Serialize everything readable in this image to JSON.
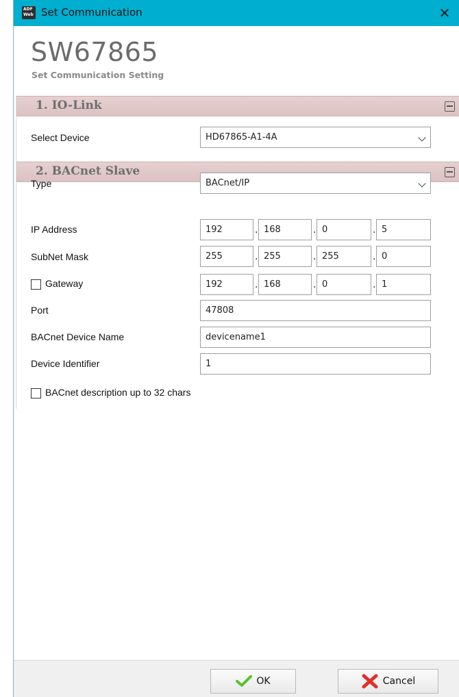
{
  "window": {
    "title": "Set Communication",
    "icon_line1": "ADF",
    "icon_line2": "Web",
    "close_glyph": "✕"
  },
  "header": {
    "product_code": "SW67865",
    "subtitle": "Set Communication Setting"
  },
  "io_link": {
    "section_title": "1. IO-Link",
    "select_device_label": "Select Device",
    "select_device_value": "HD67865-A1-4A"
  },
  "bacnet": {
    "section_title": "2. BACnet Slave",
    "type_label": "Type",
    "type_value": "BACnet/IP",
    "ip_label": "IP Address",
    "ip": [
      "192",
      "168",
      "0",
      "5"
    ],
    "subnet_label": "SubNet Mask",
    "subnet": [
      "255",
      "255",
      "255",
      "0"
    ],
    "gateway_label": "Gateway",
    "gateway_checked": false,
    "gateway": [
      "192",
      "168",
      "0",
      "1"
    ],
    "port_label": "Port",
    "port_value": "47808",
    "device_name_label": "BACnet Device Name",
    "device_name_value": "devicename1",
    "device_id_label": "Device Identifier",
    "device_id_value": "1",
    "desc_checkbox_label": "BACnet description up to 32 chars",
    "desc_checked": false,
    "dot": "."
  },
  "footer": {
    "ok_label": "OK",
    "cancel_label": "Cancel"
  },
  "colors": {
    "titlebar": "#00aed0",
    "section_header": "#dcc2c2",
    "ok_check": "#5cbf2a",
    "cancel_x": "#e0302a"
  }
}
